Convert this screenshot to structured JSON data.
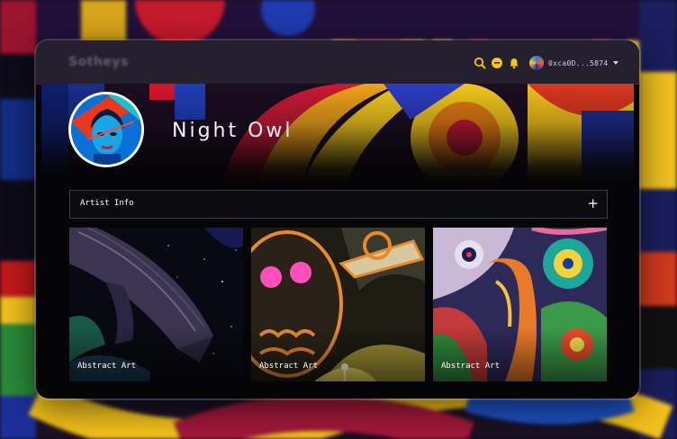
{
  "header": {
    "logo_text": "Sotheys",
    "wallet_address": "0xca0D...5874"
  },
  "icons": {
    "search": "search-icon",
    "chat": "chat-icon",
    "notifications": "bell-icon",
    "wallet_avatar": "avatar-icon",
    "dropdown": "chevron-down-icon",
    "expand": "plus-icon"
  },
  "colors": {
    "accent": "#f5c518",
    "background": "#050406",
    "text": "#f3f0f7"
  },
  "profile": {
    "name": "Night Owl"
  },
  "accordion": {
    "label": "Artist Info",
    "toggle_symbol": "+"
  },
  "gallery": {
    "cards": [
      {
        "title": "Abstract Art"
      },
      {
        "title": "Abstract Art"
      },
      {
        "title": "Abstract Art"
      }
    ]
  }
}
